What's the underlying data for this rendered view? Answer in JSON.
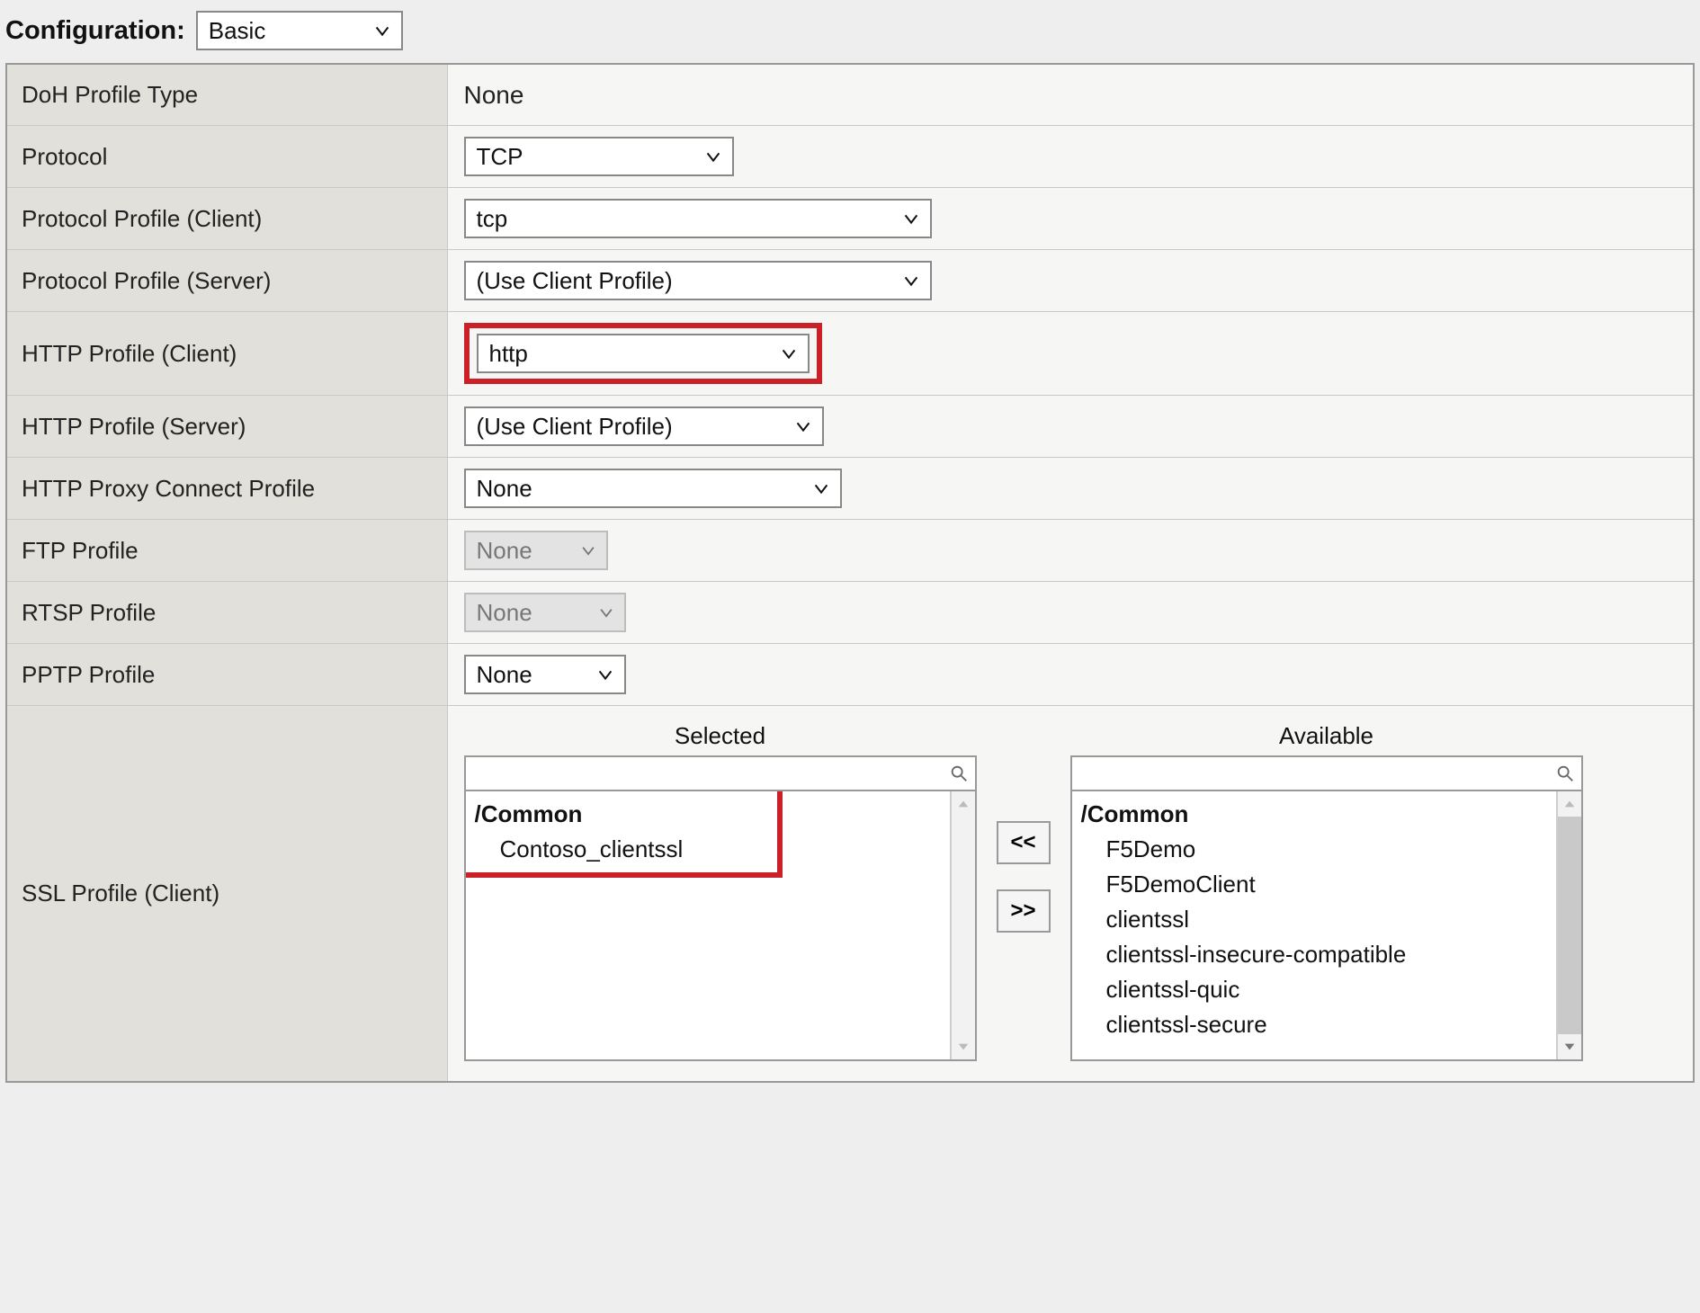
{
  "header": {
    "configuration_label": "Configuration:",
    "configuration_value": "Basic"
  },
  "rows": {
    "doh_profile_type": {
      "label": "DoH Profile Type",
      "value": "None"
    },
    "protocol": {
      "label": "Protocol",
      "value": "TCP"
    },
    "protocol_profile_client": {
      "label": "Protocol Profile (Client)",
      "value": "tcp"
    },
    "protocol_profile_server": {
      "label": "Protocol Profile (Server)",
      "value": "(Use Client Profile)"
    },
    "http_profile_client": {
      "label": "HTTP Profile (Client)",
      "value": "http"
    },
    "http_profile_server": {
      "label": "HTTP Profile (Server)",
      "value": "(Use Client Profile)"
    },
    "http_proxy_connect": {
      "label": "HTTP Proxy Connect Profile",
      "value": "None"
    },
    "ftp_profile": {
      "label": "FTP Profile",
      "value": "None"
    },
    "rtsp_profile": {
      "label": "RTSP Profile",
      "value": "None"
    },
    "pptp_profile": {
      "label": "PPTP Profile",
      "value": "None"
    },
    "ssl_profile_client": {
      "label": "SSL Profile (Client)"
    }
  },
  "dual_list": {
    "selected_header": "Selected",
    "available_header": "Available",
    "move_left_label": "<<",
    "move_right_label": ">>",
    "selected": {
      "group": "/Common",
      "items": [
        "Contoso_clientssl"
      ]
    },
    "available": {
      "group": "/Common",
      "items": [
        "F5Demo",
        "F5DemoClient",
        "clientssl",
        "clientssl-insecure-compatible",
        "clientssl-quic",
        "clientssl-secure"
      ]
    }
  }
}
